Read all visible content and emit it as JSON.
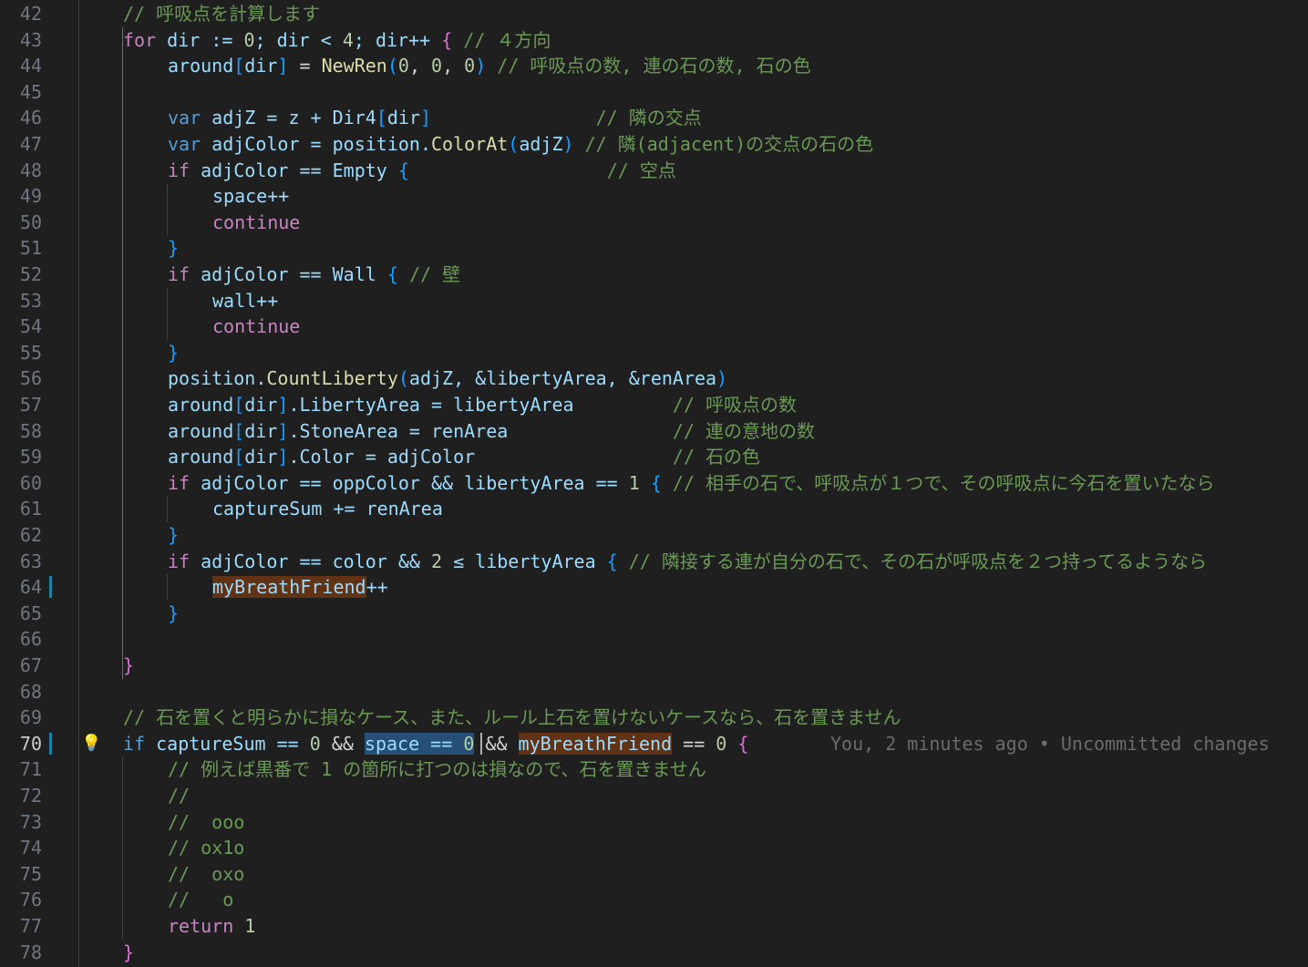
{
  "editor": {
    "first_line_number": 42,
    "active_line_number": 70,
    "blame_annotation": "You, 2 minutes ago • Uncommitted changes",
    "lines": [
      {
        "n": "42",
        "indent": 0,
        "tokens": [
          {
            "t": "// 呼吸点を計算します",
            "c": "cm"
          }
        ]
      },
      {
        "n": "43",
        "indent": 0,
        "tokens": [
          {
            "t": "for",
            "c": "ctl"
          },
          {
            "t": " dir := ",
            "c": "var"
          },
          {
            "t": "0",
            "c": "num"
          },
          {
            "t": "; dir < ",
            "c": "var"
          },
          {
            "t": "4",
            "c": "num"
          },
          {
            "t": "; dir++ ",
            "c": "var"
          },
          {
            "t": "{",
            "c": "br1"
          },
          {
            "t": " // ４方向",
            "c": "cm"
          }
        ]
      },
      {
        "n": "44",
        "indent": 1,
        "tokens": [
          {
            "t": "around",
            "c": "var"
          },
          {
            "t": "[",
            "c": "br2"
          },
          {
            "t": "dir",
            "c": "var"
          },
          {
            "t": "]",
            "c": "br2"
          },
          {
            "t": " = ",
            "c": "op"
          },
          {
            "t": "NewRen",
            "c": "fn"
          },
          {
            "t": "(",
            "c": "br2"
          },
          {
            "t": "0",
            "c": "num"
          },
          {
            "t": ", ",
            "c": "op"
          },
          {
            "t": "0",
            "c": "num"
          },
          {
            "t": ", ",
            "c": "op"
          },
          {
            "t": "0",
            "c": "num"
          },
          {
            "t": ")",
            "c": "br2"
          },
          {
            "t": " // 呼吸点の数, 連の石の数, 石の色",
            "c": "cm"
          }
        ]
      },
      {
        "n": "45",
        "indent": 1,
        "tokens": []
      },
      {
        "n": "46",
        "indent": 1,
        "tokens": [
          {
            "t": "var",
            "c": "kw"
          },
          {
            "t": " adjZ = z + ",
            "c": "var"
          },
          {
            "t": "Dir4",
            "c": "var"
          },
          {
            "t": "[",
            "c": "br2"
          },
          {
            "t": "dir",
            "c": "var"
          },
          {
            "t": "]",
            "c": "br2"
          },
          {
            "t": "               // 隣の交点",
            "c": "cm"
          }
        ]
      },
      {
        "n": "47",
        "indent": 1,
        "tokens": [
          {
            "t": "var",
            "c": "kw"
          },
          {
            "t": " adjColor = position.",
            "c": "var"
          },
          {
            "t": "ColorAt",
            "c": "fn"
          },
          {
            "t": "(",
            "c": "br2"
          },
          {
            "t": "adjZ",
            "c": "var"
          },
          {
            "t": ")",
            "c": "br2"
          },
          {
            "t": " // 隣(adjacent)の交点の石の色",
            "c": "cm"
          }
        ]
      },
      {
        "n": "48",
        "indent": 1,
        "tokens": [
          {
            "t": "if",
            "c": "ctl"
          },
          {
            "t": " adjColor == ",
            "c": "var"
          },
          {
            "t": "Empty",
            "c": "var"
          },
          {
            "t": " {",
            "c": "br2"
          },
          {
            "t": "                  // 空点",
            "c": "cm"
          }
        ]
      },
      {
        "n": "49",
        "indent": 2,
        "tokens": [
          {
            "t": "space++",
            "c": "var"
          }
        ]
      },
      {
        "n": "50",
        "indent": 2,
        "tokens": [
          {
            "t": "continue",
            "c": "ctl"
          }
        ]
      },
      {
        "n": "51",
        "indent": 1,
        "tokens": [
          {
            "t": "}",
            "c": "br2"
          }
        ]
      },
      {
        "n": "52",
        "indent": 1,
        "tokens": [
          {
            "t": "if",
            "c": "ctl"
          },
          {
            "t": " adjColor == ",
            "c": "var"
          },
          {
            "t": "Wall",
            "c": "var"
          },
          {
            "t": " {",
            "c": "br2"
          },
          {
            "t": " // 壁",
            "c": "cm"
          }
        ]
      },
      {
        "n": "53",
        "indent": 2,
        "tokens": [
          {
            "t": "wall++",
            "c": "var"
          }
        ]
      },
      {
        "n": "54",
        "indent": 2,
        "tokens": [
          {
            "t": "continue",
            "c": "ctl"
          }
        ]
      },
      {
        "n": "55",
        "indent": 1,
        "tokens": [
          {
            "t": "}",
            "c": "br2"
          }
        ]
      },
      {
        "n": "56",
        "indent": 1,
        "tokens": [
          {
            "t": "position.",
            "c": "var"
          },
          {
            "t": "CountLiberty",
            "c": "fn"
          },
          {
            "t": "(",
            "c": "br2"
          },
          {
            "t": "adjZ, &libertyArea, &renArea",
            "c": "var"
          },
          {
            "t": ")",
            "c": "br2"
          }
        ]
      },
      {
        "n": "57",
        "indent": 1,
        "tokens": [
          {
            "t": "around",
            "c": "var"
          },
          {
            "t": "[",
            "c": "br2"
          },
          {
            "t": "dir",
            "c": "var"
          },
          {
            "t": "]",
            "c": "br2"
          },
          {
            "t": ".LibertyArea = libertyArea",
            "c": "var"
          },
          {
            "t": "         // 呼吸点の数",
            "c": "cm"
          }
        ]
      },
      {
        "n": "58",
        "indent": 1,
        "tokens": [
          {
            "t": "around",
            "c": "var"
          },
          {
            "t": "[",
            "c": "br2"
          },
          {
            "t": "dir",
            "c": "var"
          },
          {
            "t": "]",
            "c": "br2"
          },
          {
            "t": ".StoneArea = renArea",
            "c": "var"
          },
          {
            "t": "               // 連の意地の数",
            "c": "cm"
          }
        ]
      },
      {
        "n": "59",
        "indent": 1,
        "tokens": [
          {
            "t": "around",
            "c": "var"
          },
          {
            "t": "[",
            "c": "br2"
          },
          {
            "t": "dir",
            "c": "var"
          },
          {
            "t": "]",
            "c": "br2"
          },
          {
            "t": ".Color = adjColor",
            "c": "var"
          },
          {
            "t": "                  // 石の色",
            "c": "cm"
          }
        ]
      },
      {
        "n": "60",
        "indent": 1,
        "tokens": [
          {
            "t": "if",
            "c": "ctl"
          },
          {
            "t": " adjColor == oppColor && libertyArea == ",
            "c": "var"
          },
          {
            "t": "1",
            "c": "num"
          },
          {
            "t": " {",
            "c": "br2"
          },
          {
            "t": " // 相手の石で、呼吸点が１つで、その呼吸点に今石を置いたなら",
            "c": "cm"
          }
        ]
      },
      {
        "n": "61",
        "indent": 2,
        "tokens": [
          {
            "t": "captureSum += renArea",
            "c": "var"
          }
        ]
      },
      {
        "n": "62",
        "indent": 1,
        "tokens": [
          {
            "t": "}",
            "c": "br2"
          }
        ]
      },
      {
        "n": "63",
        "indent": 1,
        "tokens": [
          {
            "t": "if",
            "c": "ctl"
          },
          {
            "t": " adjColor == color && ",
            "c": "var"
          },
          {
            "t": "2",
            "c": "num"
          },
          {
            "t": " ≤ libertyArea ",
            "c": "var"
          },
          {
            "t": "{",
            "c": "br2"
          },
          {
            "t": " // 隣接する連が自分の石で、その石が呼吸点を２つ持ってるようなら",
            "c": "cm"
          }
        ]
      },
      {
        "n": "64",
        "indent": 2,
        "tokens": [
          {
            "t": "myBreathFriend",
            "c": "var",
            "hl": "hl"
          },
          {
            "t": "++",
            "c": "var"
          }
        ]
      },
      {
        "n": "65",
        "indent": 1,
        "tokens": [
          {
            "t": "}",
            "c": "br2"
          }
        ]
      },
      {
        "n": "66",
        "indent": 1,
        "tokens": []
      },
      {
        "n": "67",
        "indent": 0,
        "tokens": [
          {
            "t": "}",
            "c": "br1"
          }
        ]
      },
      {
        "n": "68",
        "indent": 0,
        "tokens": []
      },
      {
        "n": "69",
        "indent": 0,
        "tokens": [
          {
            "t": "// 石を置くと明らかに損なケース、また、ルール上石を置けないケースなら、石を置きません",
            "c": "cm"
          }
        ]
      },
      {
        "n": "70",
        "indent": 0,
        "tokens": [
          {
            "t": "if",
            "c": "kw"
          },
          {
            "t": " captureSum == ",
            "c": "var"
          },
          {
            "t": "0",
            "c": "num"
          },
          {
            "t": " && ",
            "c": "op"
          },
          {
            "t": "space == ",
            "c": "var",
            "hl": "sel"
          },
          {
            "t": "0",
            "c": "num",
            "hl": "sel"
          },
          {
            "t": " && ",
            "c": "op"
          },
          {
            "t": "myBreathFriend",
            "c": "var",
            "hl": "hl"
          },
          {
            "t": " == ",
            "c": "op"
          },
          {
            "t": "0",
            "c": "num"
          },
          {
            "t": " {",
            "c": "br1"
          }
        ]
      },
      {
        "n": "71",
        "indent": 1,
        "tokens": [
          {
            "t": "// 例えば黒番で 1 の箇所に打つのは損なので、石を置きません",
            "c": "cm"
          }
        ]
      },
      {
        "n": "72",
        "indent": 1,
        "tokens": [
          {
            "t": "//",
            "c": "cm"
          }
        ]
      },
      {
        "n": "73",
        "indent": 1,
        "tokens": [
          {
            "t": "//  ooo",
            "c": "cm"
          }
        ]
      },
      {
        "n": "74",
        "indent": 1,
        "tokens": [
          {
            "t": "// ox1o",
            "c": "cm"
          }
        ]
      },
      {
        "n": "75",
        "indent": 1,
        "tokens": [
          {
            "t": "//  oxo",
            "c": "cm"
          }
        ]
      },
      {
        "n": "76",
        "indent": 1,
        "tokens": [
          {
            "t": "//   o",
            "c": "cm"
          }
        ]
      },
      {
        "n": "77",
        "indent": 1,
        "tokens": [
          {
            "t": "return",
            "c": "ctl"
          },
          {
            "t": " 1",
            "c": "num"
          }
        ]
      },
      {
        "n": "78",
        "indent": 0,
        "tokens": [
          {
            "t": "}",
            "c": "br1"
          }
        ]
      }
    ]
  }
}
